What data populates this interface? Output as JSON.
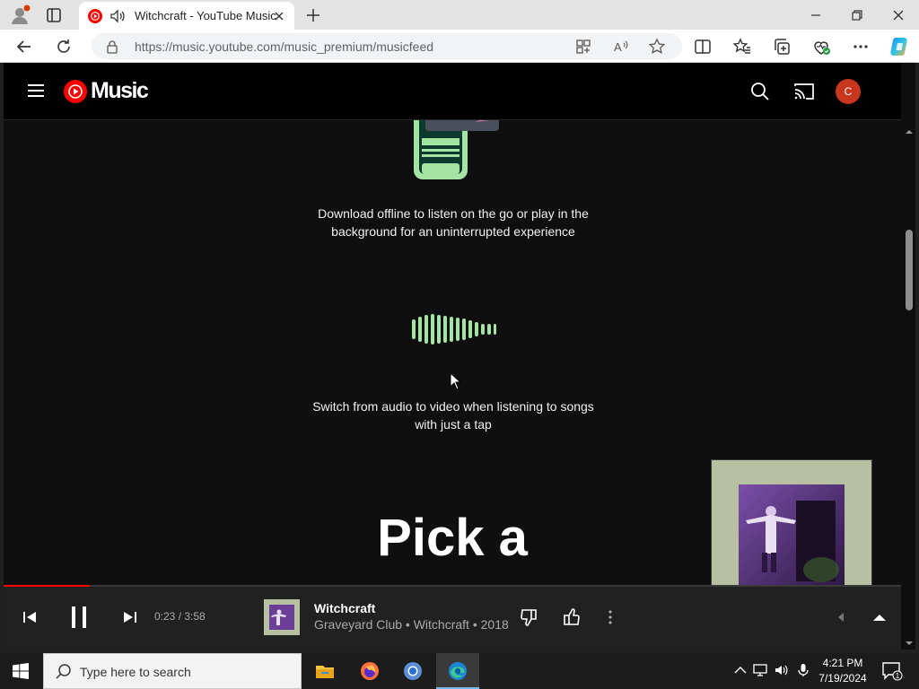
{
  "browser": {
    "tab_title": "Witchcraft - YouTube Music",
    "url": "https://music.youtube.com/music_premium/musicfeed"
  },
  "header": {
    "logo_text": "Music",
    "avatar_letter": "C"
  },
  "content": {
    "feature_download": "Download offline to listen on the go or play in the background for an uninterrupted experience",
    "feature_switch": "Switch from audio to video when listening to songs with just a tap",
    "heading": "Pick a"
  },
  "player": {
    "time": "0:23 / 3:58",
    "progress_fraction": 0.096,
    "song_title": "Witchcraft",
    "song_subtitle": "Graveyard Club • Witchcraft • 2018"
  },
  "taskbar": {
    "search_placeholder": "Type here to search",
    "time": "4:21 PM",
    "date": "7/19/2024",
    "notification_count": "1"
  },
  "colors": {
    "accent": "#ff0000",
    "avatar": "#c8371d",
    "illustration_green": "#a3e4a3"
  },
  "icons": [
    "profile-icon",
    "tab-actions-icon",
    "youtube-music-favicon",
    "audio-playing-icon",
    "close-icon",
    "new-tab-icon",
    "minimize-icon",
    "restore-icon",
    "window-close-icon",
    "back-icon",
    "refresh-icon",
    "lock-icon",
    "app-available-icon",
    "read-aloud-icon",
    "favorite-star-icon",
    "split-screen-icon",
    "favorites-icon",
    "collections-icon",
    "browser-essentials-icon",
    "more-icon",
    "copilot-icon",
    "hamburger-icon",
    "search-icon",
    "cast-icon",
    "previous-icon",
    "pause-icon",
    "next-icon",
    "thumbs-down-icon",
    "thumbs-up-icon",
    "more-vert-icon",
    "volume-icon",
    "expand-icon",
    "windows-start-icon",
    "file-explorer-icon",
    "firefox-icon",
    "chrome-icon",
    "edge-icon",
    "chevron-up-icon",
    "network-icon",
    "speaker-icon",
    "microphone-icon",
    "notification-icon"
  ]
}
